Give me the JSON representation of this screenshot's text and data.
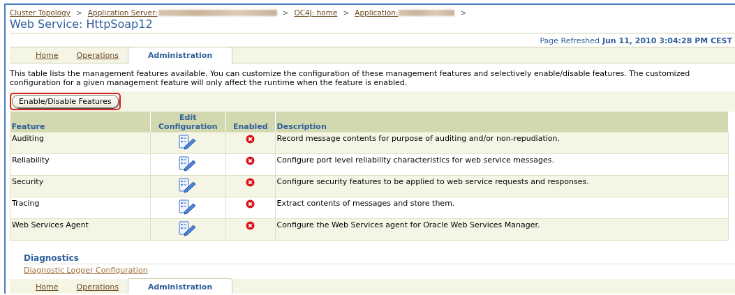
{
  "breadcrumbs": [
    {
      "label": "Cluster Topology",
      "redacted": false
    },
    {
      "label": "Application Server:",
      "redacted": true
    },
    {
      "label": "OC4J: home",
      "redacted": false
    },
    {
      "label": "Application:",
      "redacted": true
    }
  ],
  "separator": ">",
  "title": "Web Service: HttpSoap12",
  "refresh": {
    "label": "Page Refreshed",
    "time": "Jun 11, 2010 3:04:28 PM CEST"
  },
  "tabs": [
    {
      "label": "Home",
      "selected": false
    },
    {
      "label": "Operations",
      "selected": false
    },
    {
      "label": "Administration",
      "selected": true
    }
  ],
  "intro": "This table lists the management features available. You can customize the configuration of these management features and selectively enable/disable features. The customized configuration for a given management feature will only affect the runtime when the feature is enabled.",
  "action_button": "Enable/Disable Features",
  "table": {
    "columns": [
      "Feature",
      "Edit Configuration",
      "Enabled",
      "Description"
    ],
    "rows": [
      {
        "feature": "Auditing",
        "enabled": false,
        "description": "Record message contents for purpose of auditing and/or non-repudiation."
      },
      {
        "feature": "Reliability",
        "enabled": false,
        "description": "Configure port level reliability characteristics for web service messages."
      },
      {
        "feature": "Security",
        "enabled": false,
        "description": "Configure security features to be applied to web service requests and responses."
      },
      {
        "feature": "Tracing",
        "enabled": false,
        "description": "Extract contents of messages and store them."
      },
      {
        "feature": "Web Services Agent",
        "enabled": false,
        "description": "Configure the Web Services agent for Oracle Web Services Manager."
      }
    ]
  },
  "diagnostics": {
    "heading": "Diagnostics",
    "link": "Diagnostic Logger Configuration"
  },
  "bottom_tabs": [
    {
      "label": "Home",
      "selected": false
    },
    {
      "label": "Operations",
      "selected": false
    },
    {
      "label": "Administration",
      "selected": true
    }
  ]
}
